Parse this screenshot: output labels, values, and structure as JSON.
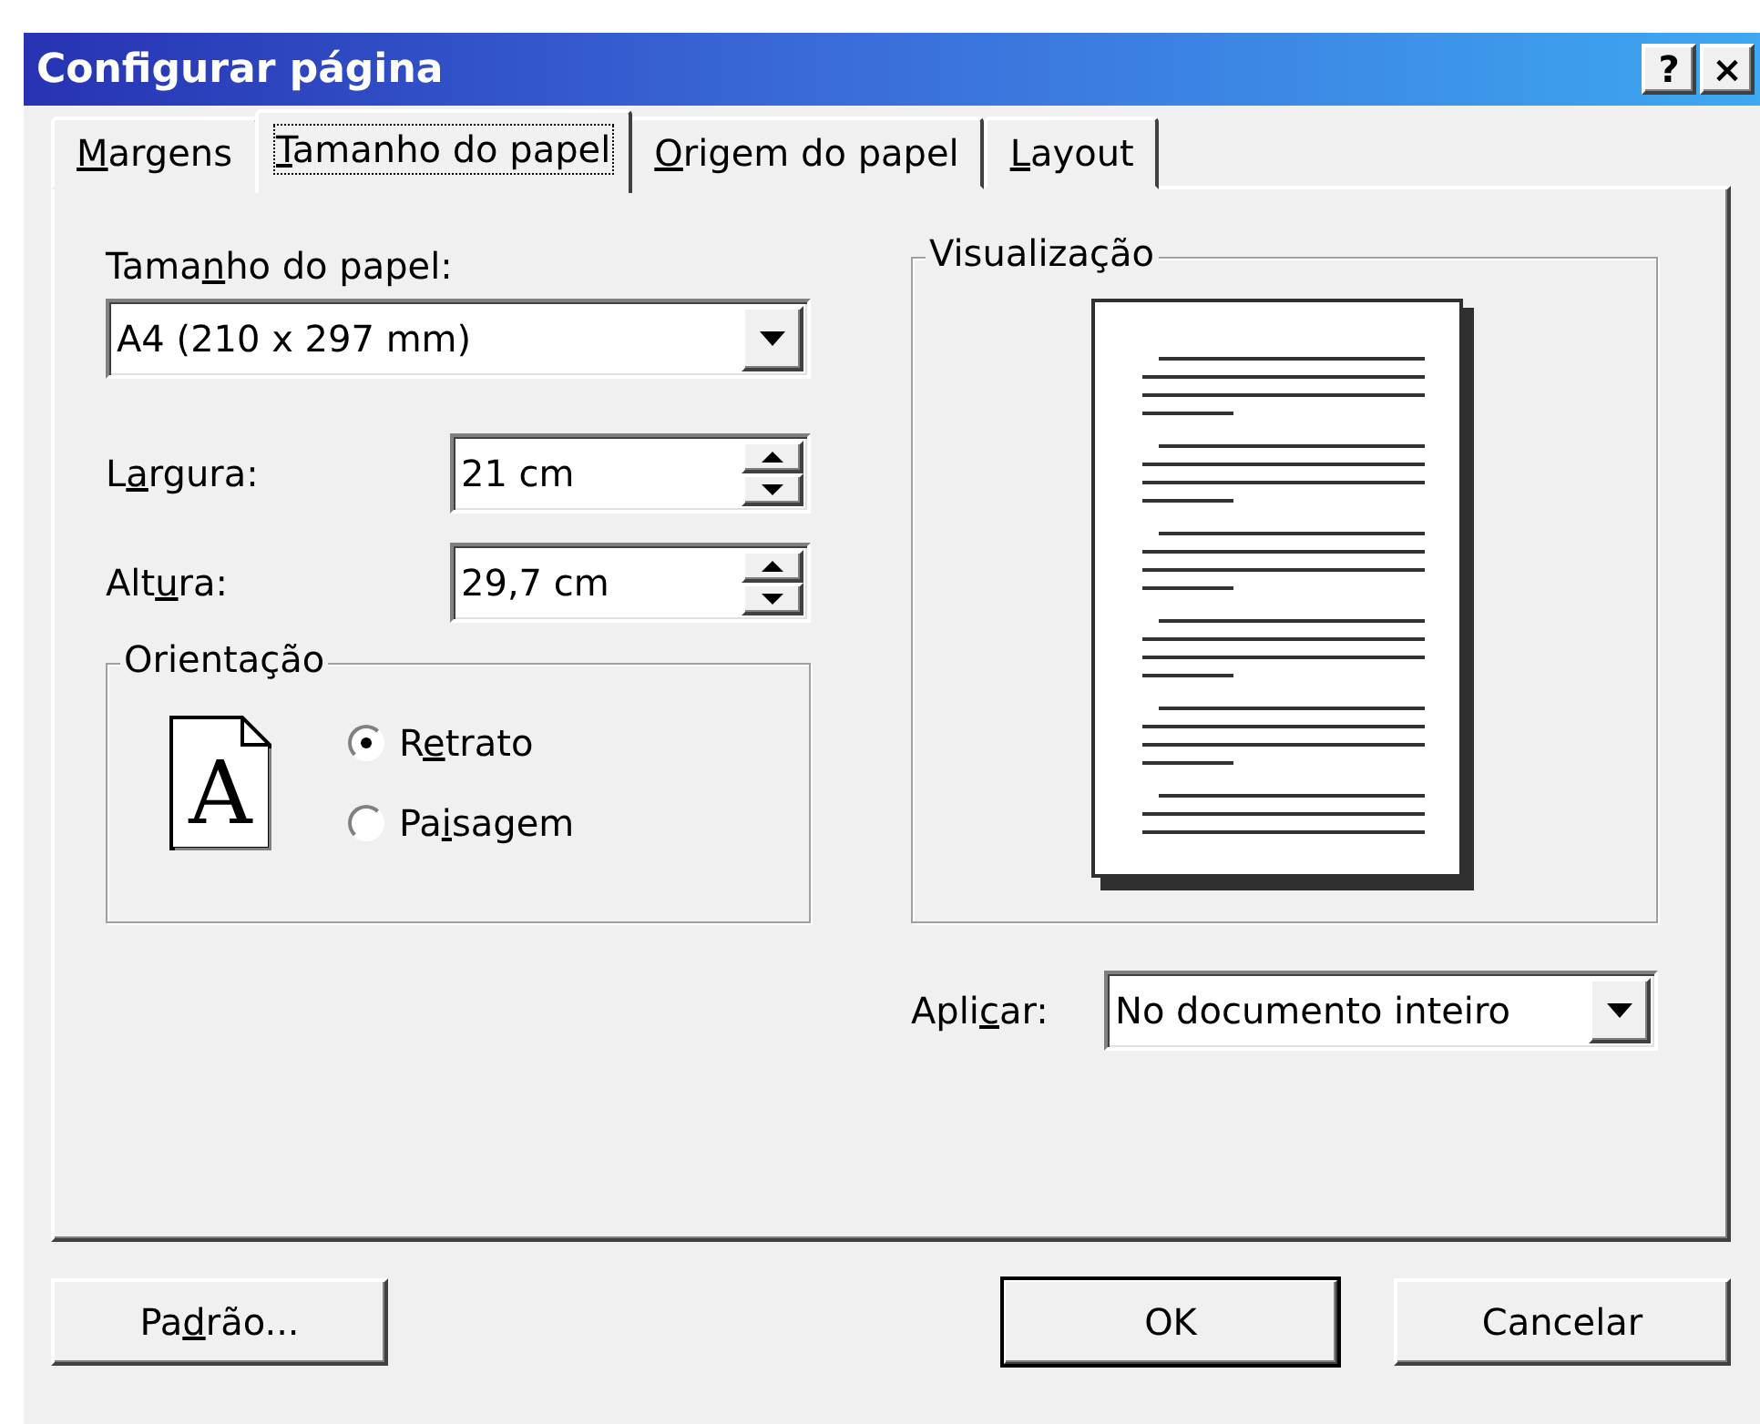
{
  "window": {
    "title": "Configurar página",
    "title_buttons": [
      "?",
      "×"
    ]
  },
  "tabs": [
    {
      "label": {
        "underlined": "M",
        "after": "argens"
      },
      "selected": false
    },
    {
      "label": {
        "underlined": "T",
        "after": "amanho do papel"
      },
      "selected": true
    },
    {
      "label": {
        "underlined": "O",
        "after": "rigem do papel"
      },
      "selected": false
    },
    {
      "label": {
        "underlined": "L",
        "after": "ayout"
      },
      "selected": false
    }
  ],
  "paper_size": {
    "label": {
      "before": "Tama",
      "underlined": "n",
      "after": "ho do papel:"
    },
    "value": "A4 (210 x 297 mm)"
  },
  "width": {
    "label": {
      "before": "L",
      "underlined": "a",
      "after": "rgura:"
    },
    "value": "21 cm"
  },
  "height": {
    "label": {
      "before": "Alt",
      "underlined": "u",
      "after": "ra:"
    },
    "value": "29,7 cm"
  },
  "orientation": {
    "title": "Orientação",
    "icon_letter": "A",
    "options": [
      {
        "label": {
          "before": "R",
          "underlined": "e",
          "after": "trato"
        },
        "selected": true
      },
      {
        "label": {
          "before": "Pa",
          "underlined": "i",
          "after": "sagem"
        },
        "selected": false
      }
    ]
  },
  "preview": {
    "title": "Visualização"
  },
  "apply_to": {
    "label": {
      "before": "Apli",
      "underlined": "c",
      "after": "ar:"
    },
    "value": "No documento inteiro"
  },
  "buttons": [
    {
      "label": {
        "before": "Pa",
        "underlined": "d",
        "after": "rão..."
      },
      "kind": "left",
      "default": false
    },
    {
      "label": {
        "after": "OK"
      },
      "kind": "right",
      "default": true
    },
    {
      "label": {
        "after": "Cancelar"
      },
      "kind": "right",
      "default": false
    }
  ]
}
